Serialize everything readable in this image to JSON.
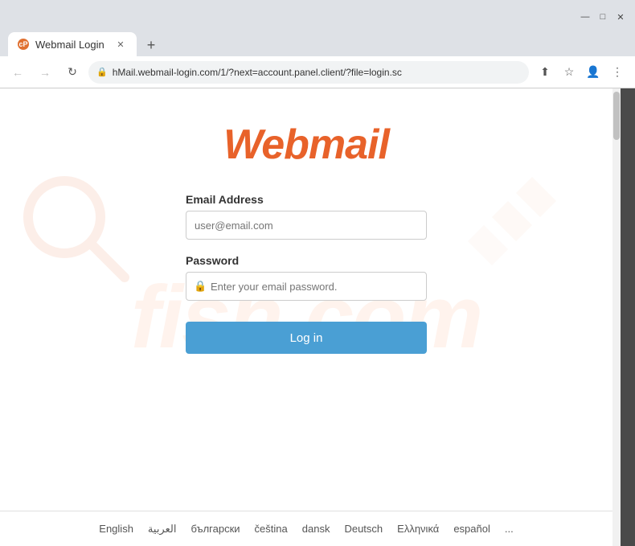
{
  "browser": {
    "title": "Webmail Login",
    "tab_label": "Webmail Login",
    "new_tab_label": "+",
    "address": "hMail.webmail-login.com/1/?next=account.panel.client/?file=login.sc",
    "favicon_letter": "cP"
  },
  "nav": {
    "back_label": "←",
    "forward_label": "→",
    "reload_label": "↻",
    "more_label": "⋮"
  },
  "page": {
    "logo": "Webmail",
    "email_label": "Email Address",
    "email_placeholder": "user@email.com",
    "password_label": "Password",
    "password_placeholder": "Enter your email password.",
    "login_button": "Log in"
  },
  "languages": [
    {
      "code": "en",
      "label": "English"
    },
    {
      "code": "ar",
      "label": "العربية"
    },
    {
      "code": "bg",
      "label": "български"
    },
    {
      "code": "cs",
      "label": "čeština"
    },
    {
      "code": "da",
      "label": "dansk"
    },
    {
      "code": "de",
      "label": "Deutsch"
    },
    {
      "code": "el",
      "label": "Ελληνικά"
    },
    {
      "code": "es",
      "label": "español"
    },
    {
      "code": "more",
      "label": "..."
    }
  ],
  "watermark": {
    "text": "fish.com"
  }
}
